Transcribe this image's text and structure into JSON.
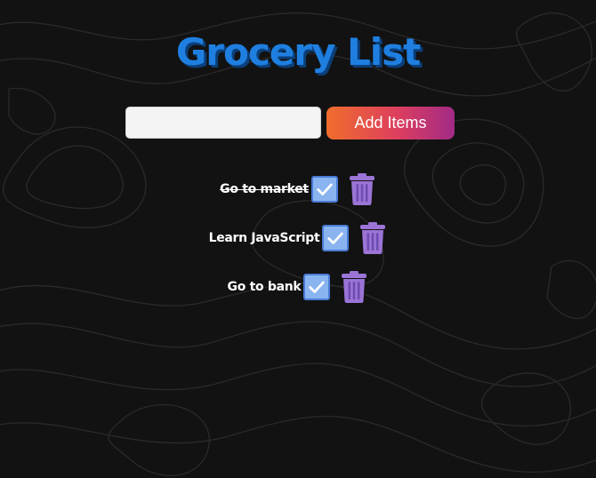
{
  "header": {
    "title": "Grocery List"
  },
  "add_form": {
    "input_value": "",
    "input_placeholder": "",
    "button_label": "Add Items"
  },
  "items": [
    {
      "label": "Go to market",
      "completed": true
    },
    {
      "label": "Learn JavaScript",
      "completed": false
    },
    {
      "label": "Go to bank",
      "completed": false
    }
  ],
  "icons": {
    "check": "check-icon",
    "delete": "trash-icon"
  },
  "colors": {
    "title": "#1f7fe0",
    "title_shadow": "#0b3f7a",
    "button_gradient_start": "#f06d2c",
    "button_gradient_end": "#a22a86",
    "check_fill": "#8ab4f0",
    "trash": "#9b74d6",
    "background": "#121212"
  }
}
